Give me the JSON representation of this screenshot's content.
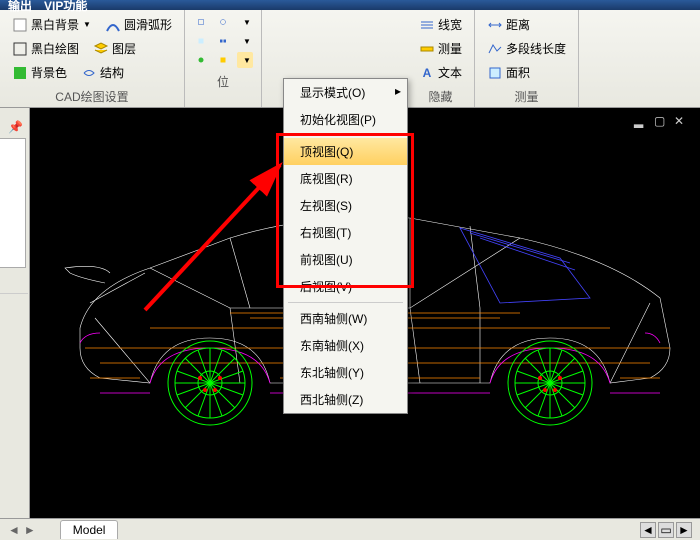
{
  "title": {
    "t1": "输出",
    "t2": "VIP功能"
  },
  "ribbon": {
    "g1": {
      "bw_bg": "黑白背景",
      "smooth": "圆滑弧形",
      "bw_draw": "黑白绘图",
      "layer": "图层",
      "bg_color": "背景色",
      "structure": "结构",
      "label": "CAD绘图设置"
    },
    "g2": {
      "label": "位"
    },
    "g3": {
      "lw": "线宽",
      "measure": "测量",
      "text": "文本",
      "label": "隐藏"
    },
    "g4": {
      "dist": "距离",
      "multi": "多段线长度",
      "area": "面积",
      "label": "测量"
    }
  },
  "menu": {
    "display_mode": "显示模式(O)",
    "init_view": "初始化视图(P)",
    "top": "顶视图(Q)",
    "bottom": "底视图(R)",
    "left": "左视图(S)",
    "right": "右视图(T)",
    "front": "前视图(U)",
    "back": "后视图(V)",
    "sw": "西南轴侧(W)",
    "se": "东南轴侧(X)",
    "ne": "东北轴侧(Y)",
    "nw": "西北轴侧(Z)"
  },
  "status": {
    "model": "Model"
  }
}
